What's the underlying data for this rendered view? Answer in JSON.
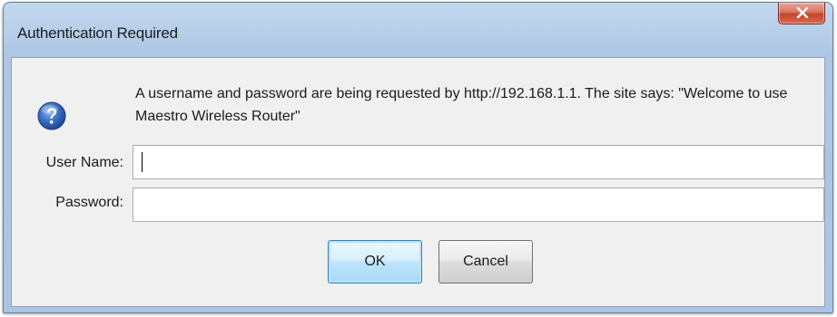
{
  "window": {
    "title": "Authentication Required",
    "close_icon": "close-icon"
  },
  "dialog": {
    "icon": "question-icon",
    "message": "A username and password are being requested by http://192.168.1.1. The site says: \"Welcome to use Maestro Wireless Router\"",
    "username_label": "User Name:",
    "username_value": "",
    "password_label": "Password:",
    "password_value": "",
    "ok_label": "OK",
    "cancel_label": "Cancel"
  },
  "colors": {
    "title_bar": "#b8cfe9",
    "client_bg": "#f0f0f0",
    "close_button": "#c4452c",
    "default_button_border": "#3c7fb1",
    "icon_blue": "#2a5fb0"
  }
}
